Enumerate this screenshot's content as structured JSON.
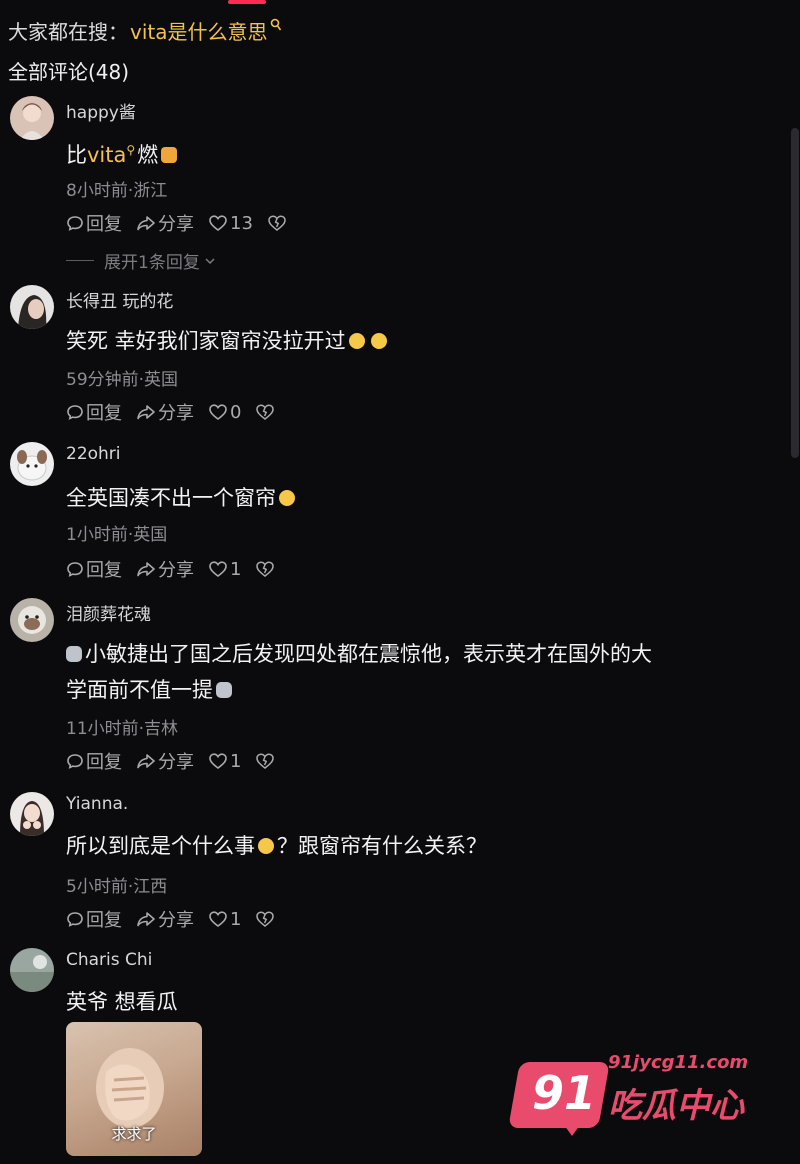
{
  "search": {
    "prefix": "大家都在搜：",
    "term": "vita是什么意思"
  },
  "comments_header": "全部评论(48)",
  "labels": {
    "reply": "回复",
    "share": "分享"
  },
  "comments": [
    {
      "username": "happy酱",
      "text_before": "比",
      "text_link": "vita",
      "text_after": "燃",
      "emoji": "thumbs-up-emoji",
      "meta": "8小时前·浙江",
      "likes": "13",
      "expand": "展开1条回复"
    },
    {
      "username": "长得丑 玩的花",
      "text": "笑死 幸好我们家窗帘没拉开过",
      "emoji": "crying-face-emoji",
      "meta": "59分钟前·英国",
      "likes": "0"
    },
    {
      "username": "22ohri",
      "text": "全英国凑不出一个窗帘",
      "emoji": "rolling-laughing-emoji",
      "meta": "1小时前·英国",
      "likes": "1"
    },
    {
      "username": "泪颜葬花魂",
      "text_line1": "小敏捷出了国之后发现四处都在震惊他，表示英才在国外的大",
      "text_line2": "学面前不值一提",
      "emoji": "cat-face-emoji",
      "meta": "11小时前·吉林",
      "likes": "1"
    },
    {
      "username": "Yianna.",
      "text_before": "所以到底是个什么事",
      "text_after": "？跟窗帘有什么关系？",
      "emoji": "smiling-face-emoji",
      "meta": "5小时前·江西",
      "likes": "1"
    },
    {
      "username": "Charis Chi",
      "text": "英爷 想看瓜",
      "image_caption": "求求了"
    }
  ],
  "watermark": {
    "number": "91",
    "url": "91jycg11.com",
    "name": "吃瓜中心"
  },
  "colors": {
    "background": "#0b0a0d",
    "highlight": "#f2c14e",
    "accent": "#fe2c55",
    "watermark": "#e94b6d"
  }
}
